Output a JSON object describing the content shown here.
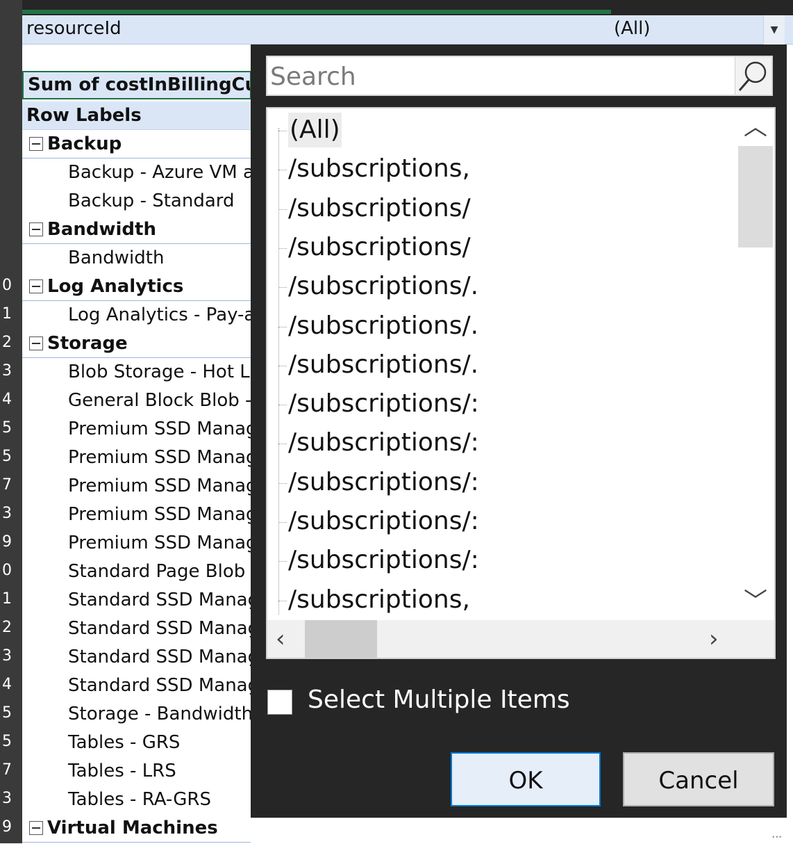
{
  "filter": {
    "field": "resourceId",
    "value": "(All)"
  },
  "row_numbers": [
    "0",
    "1",
    "2",
    "3",
    "4",
    "5",
    "5",
    "7",
    "3",
    "9",
    "0",
    "1",
    "2",
    "3",
    "4",
    "5",
    "5",
    "7",
    "3",
    "9"
  ],
  "pivot": {
    "sum_header": "Sum of costInBillingCurr",
    "row_labels": "Row Labels",
    "rows": [
      {
        "type": "cat",
        "label": "Backup"
      },
      {
        "type": "item",
        "label": "Backup - Azure VM a"
      },
      {
        "type": "item",
        "label": "Backup - Standard"
      },
      {
        "type": "cat",
        "label": "Bandwidth"
      },
      {
        "type": "item",
        "label": "Bandwidth"
      },
      {
        "type": "cat",
        "label": "Log Analytics"
      },
      {
        "type": "item",
        "label": "Log Analytics - Pay-as"
      },
      {
        "type": "cat",
        "label": "Storage"
      },
      {
        "type": "item",
        "label": "Blob Storage - Hot LF"
      },
      {
        "type": "item",
        "label": "General Block Blob -"
      },
      {
        "type": "item",
        "label": "Premium SSD Manag"
      },
      {
        "type": "item",
        "label": "Premium SSD Manag"
      },
      {
        "type": "item",
        "label": "Premium SSD Manag"
      },
      {
        "type": "item",
        "label": "Premium SSD Manag"
      },
      {
        "type": "item",
        "label": "Premium SSD Manag"
      },
      {
        "type": "item",
        "label": "Standard Page Blob -"
      },
      {
        "type": "item",
        "label": "Standard SSD Manag"
      },
      {
        "type": "item",
        "label": "Standard SSD Manag"
      },
      {
        "type": "item",
        "label": "Standard SSD Manag"
      },
      {
        "type": "item",
        "label": "Standard SSD Manag"
      },
      {
        "type": "item",
        "label": "Storage - Bandwidth"
      },
      {
        "type": "item",
        "label": "Tables - GRS"
      },
      {
        "type": "item",
        "label": "Tables - LRS"
      },
      {
        "type": "item",
        "label": "Tables - RA-GRS"
      },
      {
        "type": "cat",
        "label": "Virtual Machines"
      }
    ]
  },
  "dropdown": {
    "search_placeholder": "Search",
    "items": [
      "(All)",
      "/subscriptions,",
      "/subscriptions/",
      "/subscriptions/",
      "/subscriptions/.",
      "/subscriptions/.",
      "/subscriptions/.",
      "/subscriptions/:",
      "/subscriptions/:",
      "/subscriptions/:",
      "/subscriptions/:",
      "/subscriptions/:",
      "/subscriptions,"
    ],
    "selected_index": 0,
    "select_multiple_label": "Select Multiple Items",
    "select_multiple_checked": false,
    "ok_label": "OK",
    "cancel_label": "Cancel"
  }
}
